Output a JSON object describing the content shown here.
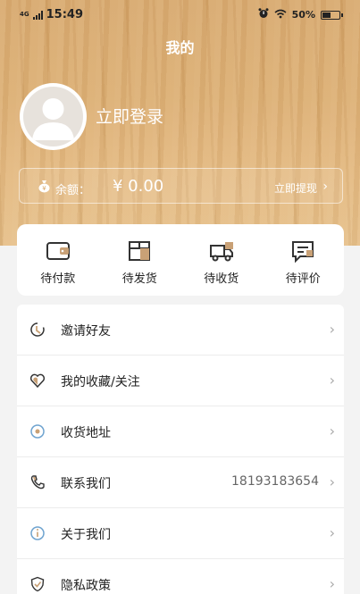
{
  "status_bar": {
    "network": "4G",
    "time": "15:49",
    "battery": "50%"
  },
  "page_title": "我的",
  "profile": {
    "login_text": "立即登录"
  },
  "balance": {
    "label": "余额：",
    "value": "¥ 0.00",
    "withdraw_label": "立即提现"
  },
  "orders": [
    {
      "label": "待付款",
      "icon": "wallet-icon"
    },
    {
      "label": "待发货",
      "icon": "package-icon"
    },
    {
      "label": "待收货",
      "icon": "truck-icon"
    },
    {
      "label": "待评价",
      "icon": "comment-icon"
    }
  ],
  "menu": [
    {
      "label": "邀请好友",
      "icon": "invite-icon",
      "extra": ""
    },
    {
      "label": "我的收藏/关注",
      "icon": "heart-icon",
      "extra": ""
    },
    {
      "label": "收货地址",
      "icon": "location-icon",
      "extra": ""
    },
    {
      "label": "联系我们",
      "icon": "phone-icon",
      "extra": "18193183654"
    },
    {
      "label": "关于我们",
      "icon": "info-icon",
      "extra": ""
    },
    {
      "label": "隐私政策",
      "icon": "shield-icon",
      "extra": ""
    }
  ],
  "colors": {
    "accent": "#c9a176",
    "wood": "#dcae72"
  }
}
